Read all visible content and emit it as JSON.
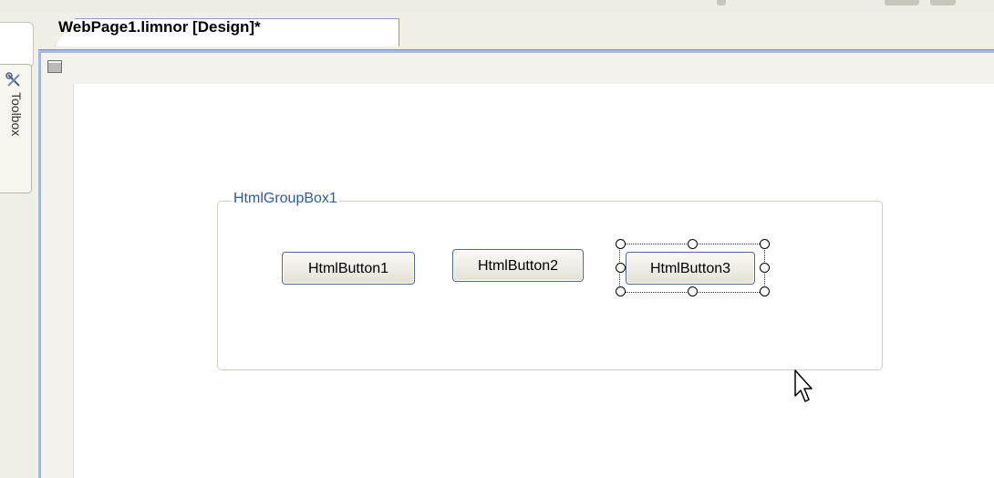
{
  "toolbox": {
    "label": "Toolbox",
    "icon": "wrench-screwdriver-icon"
  },
  "tab": {
    "title": "WebPage1.limnor [Design]*"
  },
  "designer": {
    "component_icon": "component-tray-icon",
    "groupbox": {
      "title": "HtmlGroupBox1"
    },
    "buttons": [
      {
        "label": "HtmlButton1"
      },
      {
        "label": "HtmlButton2"
      },
      {
        "label": "HtmlButton3",
        "selected": true
      }
    ]
  },
  "colors": {
    "tab_accent": "#a7b9e0",
    "groupbox_title": "#2a5aa8",
    "button_border": "#4f6a92"
  }
}
